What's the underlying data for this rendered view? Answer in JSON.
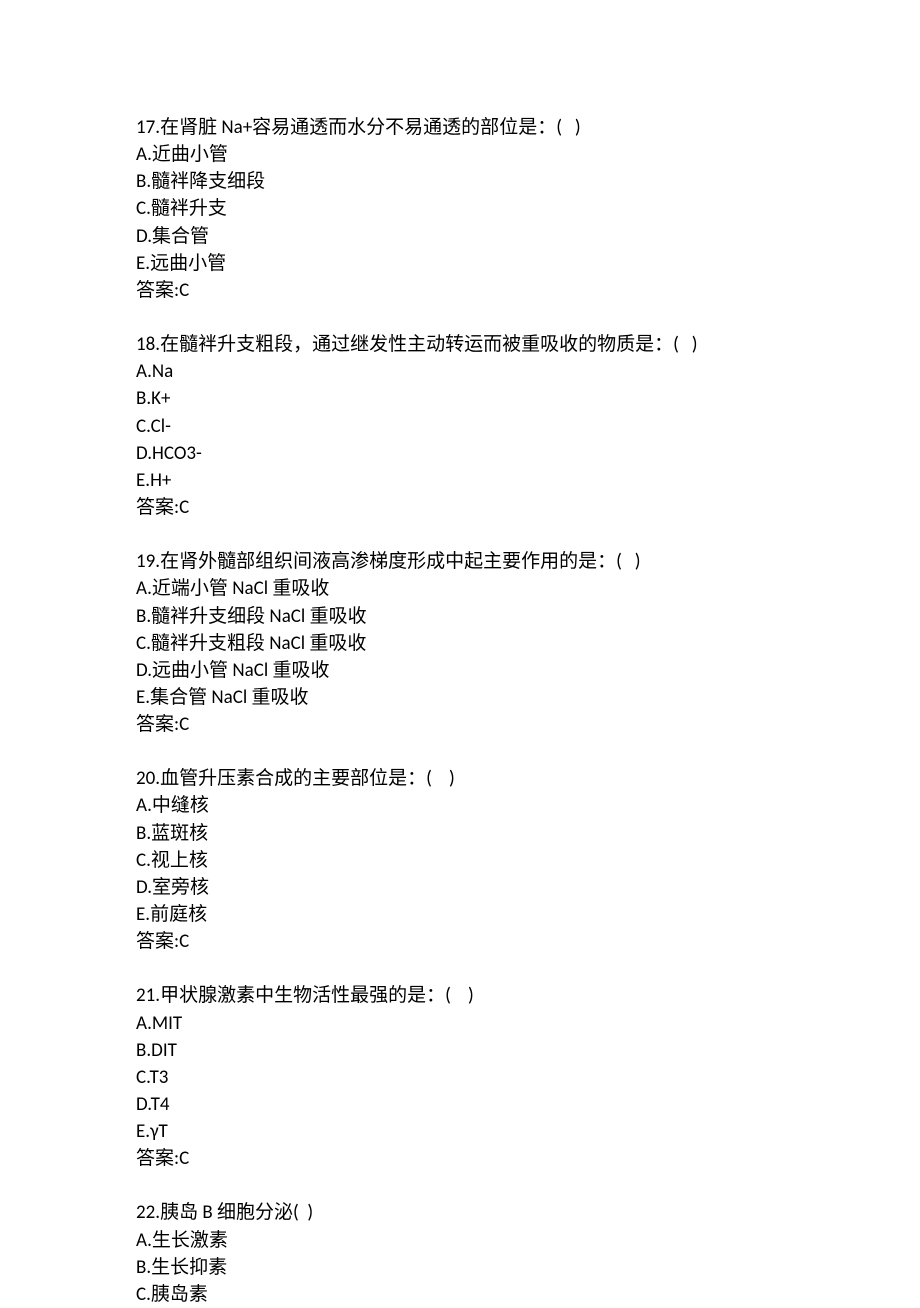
{
  "questions": [
    {
      "number": "17",
      "stem": "在肾脏 Na+容易通透而水分不易通透的部位是：(   )",
      "options": [
        "A.近曲小管",
        "B.髓袢降支细段",
        "C.髓袢升支",
        "D.集合管",
        "E.远曲小管"
      ],
      "answer_label": "答案:C"
    },
    {
      "number": "18",
      "stem": "在髓袢升支粗段，通过继发性主动转运而被重吸收的物质是：(   )",
      "options": [
        "A.Na",
        "B.K+",
        "C.Cl-",
        "D.HCO3-",
        "E.H+"
      ],
      "answer_label": "答案:C"
    },
    {
      "number": "19",
      "stem": "在肾外髓部组织间液高渗梯度形成中起主要作用的是：(   )",
      "options": [
        "A.近端小管 NaCl 重吸收",
        "B.髓袢升支细段 NaCl 重吸收",
        "C.髓袢升支粗段 NaCl 重吸收",
        "D.远曲小管 NaCl 重吸收",
        "E.集合管 NaCl 重吸收"
      ],
      "answer_label": "答案:C"
    },
    {
      "number": "20",
      "stem": "血管升压素合成的主要部位是：(    )",
      "options": [
        "A.中缝核",
        "B.蓝斑核",
        "C.视上核",
        "D.室旁核",
        "E.前庭核"
      ],
      "answer_label": "答案:C"
    },
    {
      "number": "21",
      "stem": "甲状腺激素中生物活性最强的是：(    )",
      "options": [
        "A.MIT",
        "B.DIT",
        "C.T3",
        "D.T4",
        "E.γT"
      ],
      "answer_label": "答案:C"
    },
    {
      "number": "22",
      "stem": "胰岛 B 细胞分泌(  )",
      "options": [
        "A.生长激素",
        "B.生长抑素",
        "C.胰岛素"
      ],
      "answer_label": ""
    }
  ]
}
